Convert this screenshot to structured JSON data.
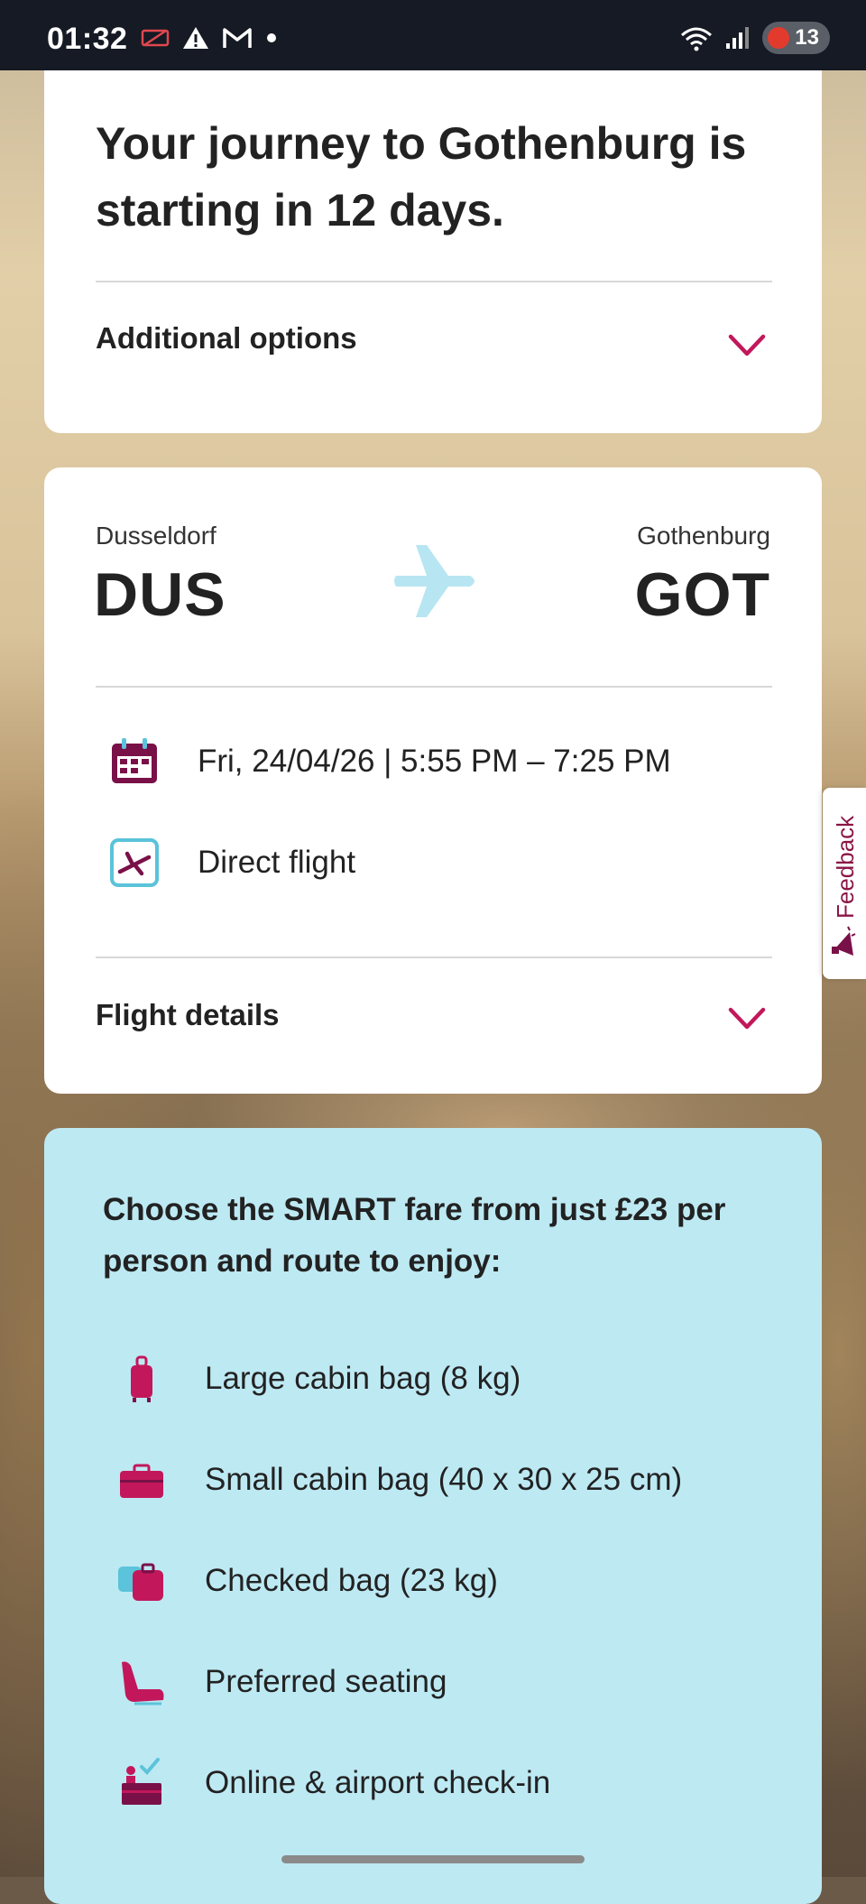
{
  "status_bar": {
    "time": "01:32",
    "battery": "13",
    "icons_left": [
      "cast-off-icon",
      "warning-icon",
      "gmail-icon",
      "dot-icon"
    ],
    "icons_right": [
      "wifi-icon",
      "signal-icon",
      "battery-icon"
    ]
  },
  "journey": {
    "title": "Your journey to Gothenburg is starting in 12 days.",
    "additional_options": "Additional options"
  },
  "flight": {
    "origin_city": "Dusseldorf",
    "origin_code": "DUS",
    "destination_city": "Gothenburg",
    "destination_code": "GOT",
    "datetime": "Fri, 24/04/26 | 5:55 PM – 7:25 PM",
    "type": "Direct flight",
    "details_label": "Flight details"
  },
  "promo": {
    "title": "Choose the SMART fare from just £23 per person and route to enjoy:",
    "benefits": [
      {
        "icon": "trolley-bag-icon",
        "label": "Large cabin bag (8 kg)"
      },
      {
        "icon": "briefcase-icon",
        "label": "Small cabin bag (40 x 30 x 25 cm)"
      },
      {
        "icon": "checked-bag-icon",
        "label": "Checked bag (23 kg)"
      },
      {
        "icon": "seat-icon",
        "label": "Preferred seating"
      },
      {
        "icon": "check-in-desk-icon",
        "label": "Online & airport check-in"
      }
    ]
  },
  "feedback": {
    "label": "Feedback"
  },
  "colors": {
    "accent": "#c2185b",
    "dark_purple": "#7a1048",
    "promo_bg": "#bde9f3",
    "plane_light_blue": "#b7e6f2"
  }
}
